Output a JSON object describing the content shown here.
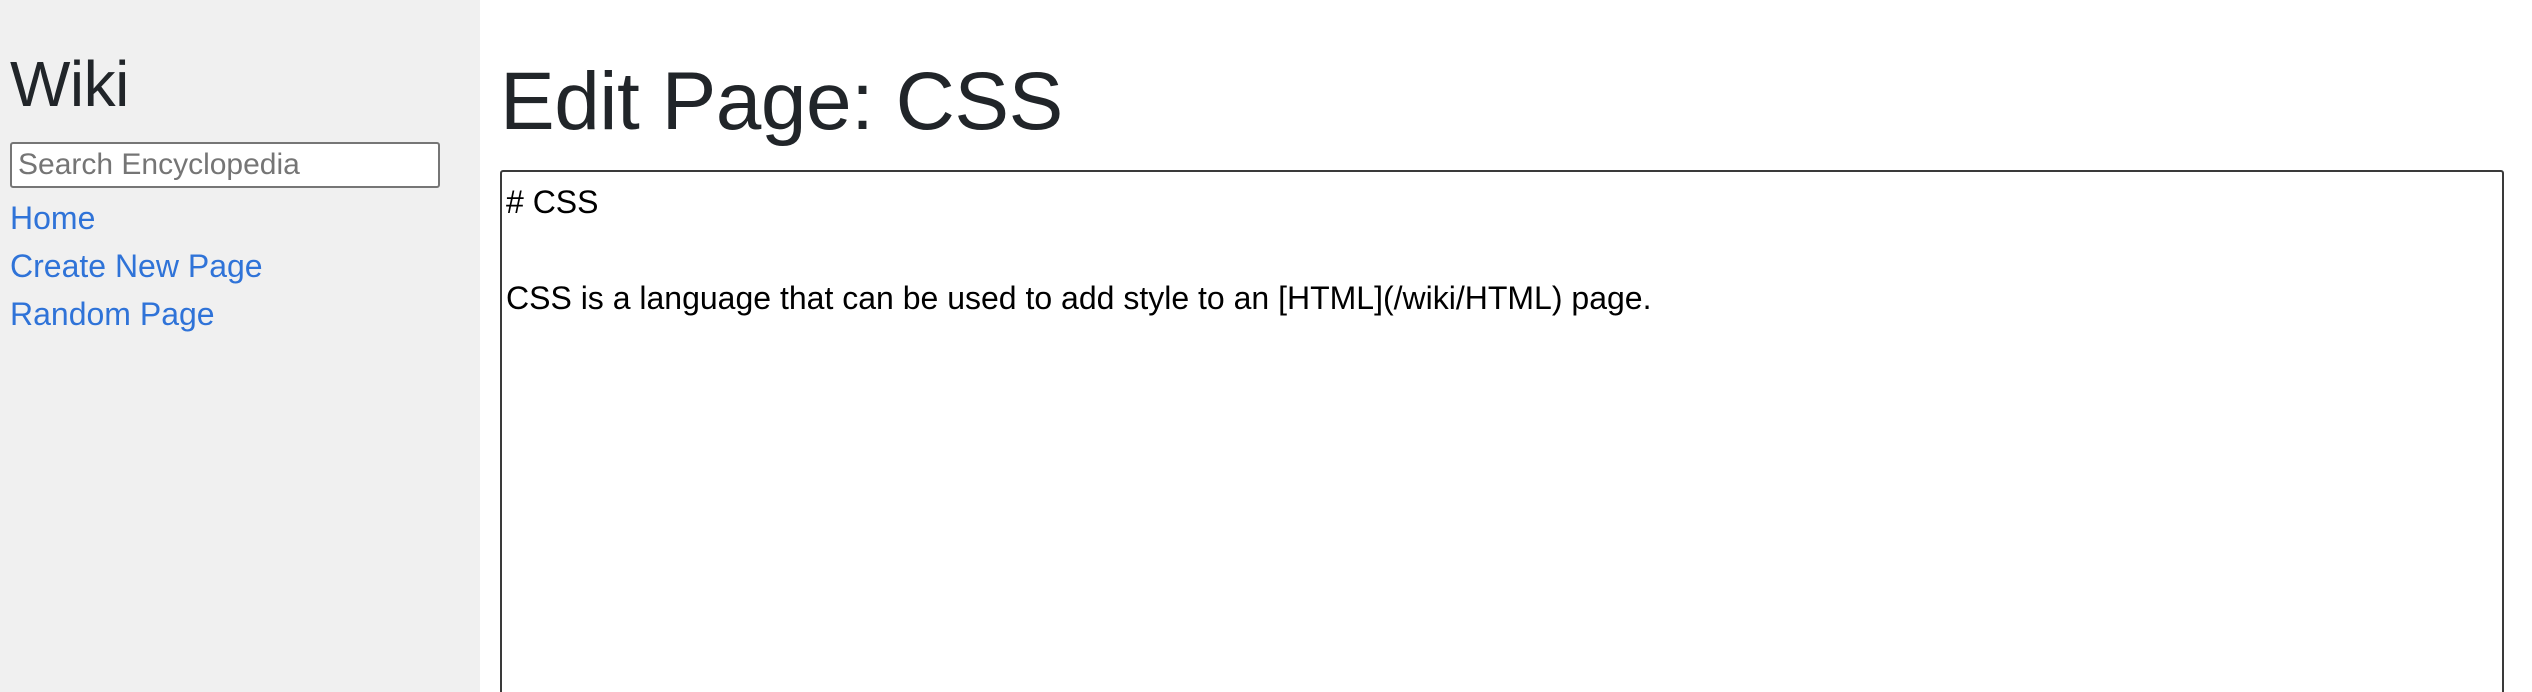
{
  "sidebar": {
    "title": "Wiki",
    "search": {
      "placeholder": "Search Encyclopedia",
      "value": ""
    },
    "nav": [
      {
        "label": "Home"
      },
      {
        "label": "Create New Page"
      },
      {
        "label": "Random Page"
      }
    ]
  },
  "main": {
    "heading": "Edit Page: CSS",
    "editor": {
      "content": "# CSS\n\nCSS is a language that can be used to add style to an [HTML](/wiki/HTML) page."
    }
  },
  "colors": {
    "sidebar_bg": "#f0f0f0",
    "link": "#2f73d8",
    "text": "#212529"
  }
}
